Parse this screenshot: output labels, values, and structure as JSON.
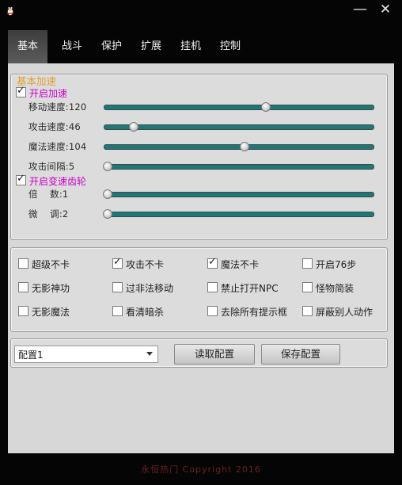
{
  "tabs": [
    "基本",
    "战斗",
    "保护",
    "扩展",
    "挂机",
    "控制"
  ],
  "window_controls": {
    "minimize": "—",
    "close": "✕"
  },
  "speed_group": {
    "title": "基本加速",
    "enable_speed": {
      "label": "开启加速",
      "checked": true
    },
    "sliders": [
      {
        "label": "移动速度:120",
        "level": 0.6
      },
      {
        "label": "攻击速度:46",
        "level": 0.11
      },
      {
        "label": "魔法速度:104",
        "level": 0.52
      },
      {
        "label": "攻击间隔:5",
        "level": 0.0
      }
    ],
    "enable_gear": {
      "label": "开启变速齿轮",
      "checked": true
    },
    "gear_sliders": [
      {
        "label": "倍    数:1",
        "level": 0.0
      },
      {
        "label": "微    调:2",
        "level": 0.015
      }
    ]
  },
  "options": [
    {
      "label": "超级不卡",
      "checked": false
    },
    {
      "label": "攻击不卡",
      "checked": true
    },
    {
      "label": "魔法不卡",
      "checked": true
    },
    {
      "label": "开启76步",
      "checked": false
    },
    {
      "label": "无影神功",
      "checked": false
    },
    {
      "label": "过非法移动",
      "checked": false
    },
    {
      "label": "禁止打开NPC",
      "checked": false
    },
    {
      "label": "怪物简装",
      "checked": false
    },
    {
      "label": "无影魔法",
      "checked": false
    },
    {
      "label": "看清暗杀",
      "checked": false
    },
    {
      "label": "去除所有提示框",
      "checked": false
    },
    {
      "label": "屏蔽别人动作",
      "checked": false
    }
  ],
  "config": {
    "selected": "配置1",
    "load_button": "读取配置",
    "save_button": "保存配置"
  },
  "footer": "永恒热门    Copyright 2016",
  "colors": {
    "accent_title": "#e0a030",
    "checkbox_label": "#cc00cc",
    "track": "#1e7878"
  }
}
